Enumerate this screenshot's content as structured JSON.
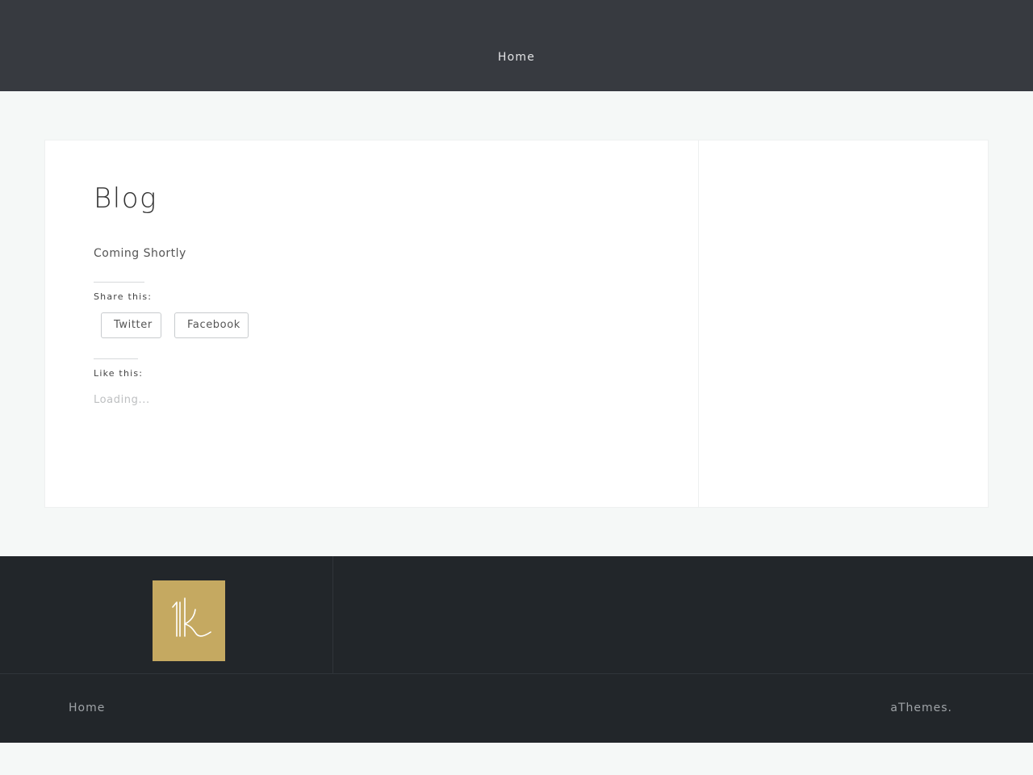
{
  "header": {
    "nav": [
      {
        "label": "Home"
      }
    ]
  },
  "post": {
    "title": "Blog",
    "body": "Coming Shortly"
  },
  "share": {
    "heading": "Share this:",
    "buttons": [
      {
        "label": "Twitter"
      },
      {
        "label": "Facebook"
      }
    ]
  },
  "likes": {
    "heading": "Like this:",
    "status": "Loading..."
  },
  "footer": {
    "logo_icon": "k-monogram-logo",
    "logo_color": "#c5a961",
    "nav": [
      {
        "label": "Home"
      }
    ],
    "credit": "aThemes."
  },
  "colors": {
    "header_bg": "#373a40",
    "footer_bg": "#22262a",
    "page_bg": "#f5f8f7"
  }
}
